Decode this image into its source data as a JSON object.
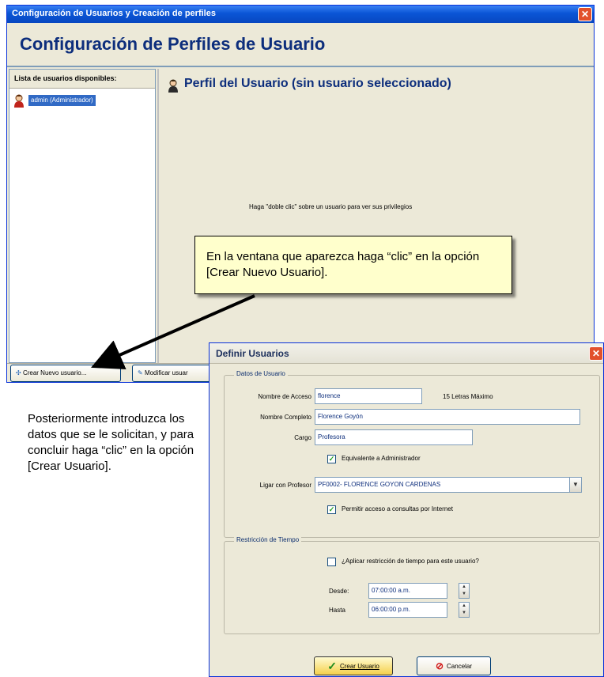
{
  "main_window": {
    "title": "Configuración de Usuarios y Creación de perfiles",
    "heading": "Configuración de Perfiles de Usuario",
    "user_list": {
      "title": "Lista de usuarios disponibles:",
      "items": [
        {
          "label": "admin (Administrador)"
        }
      ]
    },
    "profile": {
      "title": "Perfil del Usuario (sin usuario seleccionado)",
      "hint": "Haga \"doble clic\" sobre un usuario para ver sus privilegios"
    },
    "footer": {
      "create_button": "Crear Nuevo usuario...",
      "modify_button": "Modificar usuar"
    }
  },
  "callout": {
    "text": "En la ventana que aparezca haga “clic” en la opción [Crear Nuevo Usuario]."
  },
  "instructions": {
    "text": "Posteriormente introduzca los datos que se le solicitan, y para concluir haga “clic” en la opción [Crear Usuario]."
  },
  "dialog": {
    "title": "Definir Usuarios",
    "datos": {
      "legend": "Datos de Usuario",
      "login_label": "Nombre de Acceso",
      "login_value": "florence",
      "login_note": "15 Letras Máximo",
      "fullname_label": "Nombre Completo",
      "fullname_value": "Florence Goyón",
      "cargo_label": "Cargo",
      "cargo_value": "Profesora",
      "admin_checkbox": "Equivalente a Administrador",
      "profesor_label": "Ligar con Profesor",
      "profesor_value": "PF0002- FLORENCE GOYON CARDENAS",
      "internet_checkbox": "Permitir acceso a consultas por Internet"
    },
    "tiempo": {
      "legend": "Restricción de Tiempo",
      "apply_checkbox": "¿Aplicar restricción de tiempo para este usuario?",
      "desde_label": "Desde:",
      "desde_value": "07:00:00 a.m.",
      "hasta_label": "Hasta",
      "hasta_value": "06:00:00 p.m."
    },
    "buttons": {
      "create": "Crear Usuario",
      "cancel": "Cancelar"
    }
  }
}
